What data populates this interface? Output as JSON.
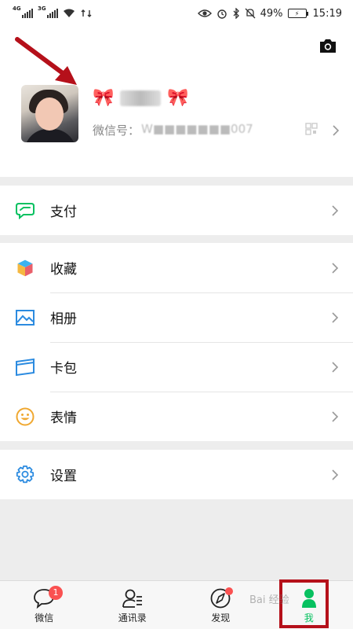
{
  "status_bar": {
    "network1": "4G",
    "network2": "3G",
    "battery_percent": "49%",
    "time": "15:19"
  },
  "profile": {
    "bow_left": "🎀",
    "bow_right": "🎀",
    "wechat_id_label": "微信号：",
    "wechat_id_value": "W■■■■■■■007"
  },
  "menu": {
    "pay": "支付",
    "favorites": "收藏",
    "album": "相册",
    "cards": "卡包",
    "stickers": "表情",
    "settings": "设置"
  },
  "tabs": {
    "chats": "微信",
    "chats_badge": "1",
    "contacts": "通讯录",
    "discover": "发现",
    "me": "我"
  },
  "watermark": "Bai 经验",
  "colors": {
    "accent_green": "#07c160",
    "badge_red": "#fa5151",
    "highlight_red": "#b5101a"
  }
}
